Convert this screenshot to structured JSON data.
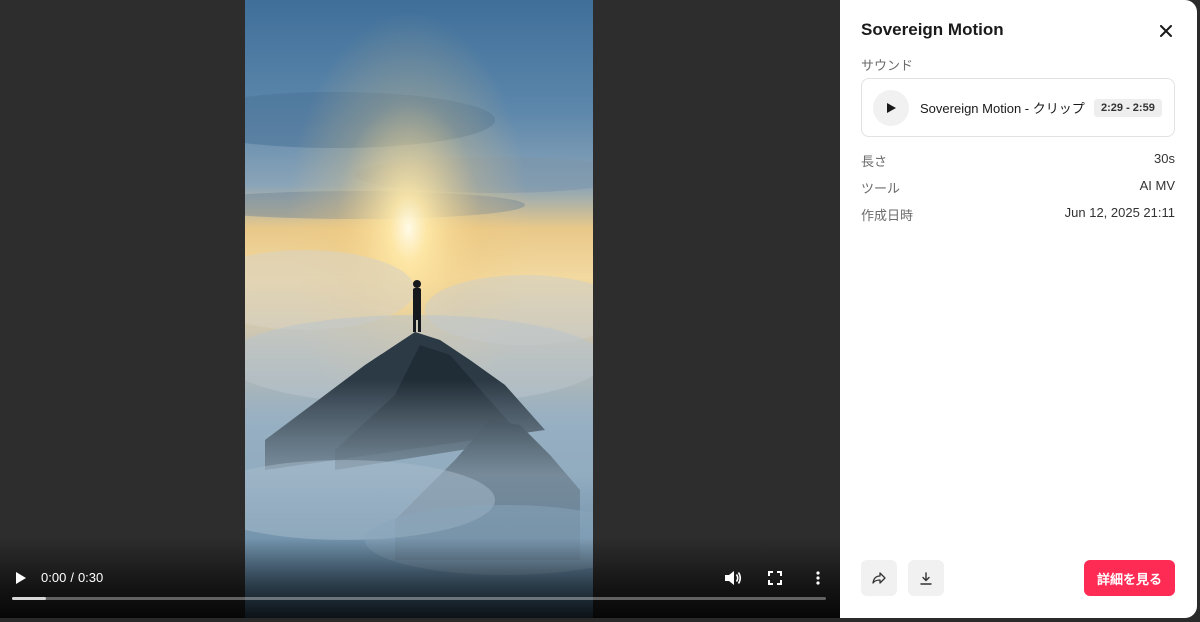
{
  "player": {
    "current_time": "0:00",
    "separator": "/",
    "duration": "0:30",
    "progress_fraction": 0.0
  },
  "panel": {
    "title": "Sovereign Motion",
    "sound_section_label": "サウンド",
    "sound": {
      "name": "Sovereign Motion - クリップ",
      "range": "2:29 - 2:59"
    },
    "meta": [
      {
        "key": "長さ",
        "value": "30s"
      },
      {
        "key": "ツール",
        "value": "AI MV"
      },
      {
        "key": "作成日時",
        "value": "Jun 12, 2025 21:11"
      }
    ],
    "detail_button_label": "詳細を見る"
  },
  "colors": {
    "accent": "#fe2c55",
    "backdrop": "#2d2d2d"
  },
  "icons": {
    "play": "play-icon",
    "volume": "volume-icon",
    "fullscreen": "fullscreen-icon",
    "more": "more-vertical-icon",
    "close": "close-icon",
    "share": "share-icon",
    "download": "download-icon"
  }
}
